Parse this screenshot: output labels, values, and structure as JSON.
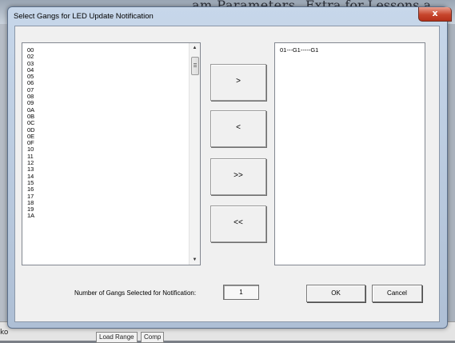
{
  "background_app": {
    "title_fragment_1": "am Parameters",
    "title_fragment_2": "Extra for Lessons a",
    "status_left": "ko",
    "status_tab_1": "Load Range",
    "status_tab_2": "Comp"
  },
  "dialog": {
    "title": "Select Gangs for LED Update Notification",
    "close_glyph": "x"
  },
  "available_gangs": {
    "items": [
      "00",
      "02",
      "03",
      "04",
      "05",
      "06",
      "07",
      "08",
      "09",
      "0A",
      "0B",
      "0C",
      "0D",
      "0E",
      "0F",
      "10",
      "11",
      "12",
      "13",
      "14",
      "15",
      "16",
      "17",
      "18",
      "19",
      "1A"
    ]
  },
  "selected_gangs": {
    "items": [
      "01---G1-----G1"
    ]
  },
  "transfer_buttons": {
    "add": ">",
    "remove": "<",
    "add_all": ">>",
    "remove_all": "<<"
  },
  "footer": {
    "count_label": "Number of Gangs Selected for Notification:",
    "count_value": "1",
    "ok_label": "OK",
    "cancel_label": "Cancel"
  },
  "colors": {
    "frame": "#aebfd5",
    "close_button": "#c7452c",
    "client_bg": "#f0f0f0"
  },
  "icons": {
    "scroll_up": "scroll-up-arrow-icon",
    "scroll_down": "scroll-down-arrow-icon",
    "close": "close-icon"
  }
}
